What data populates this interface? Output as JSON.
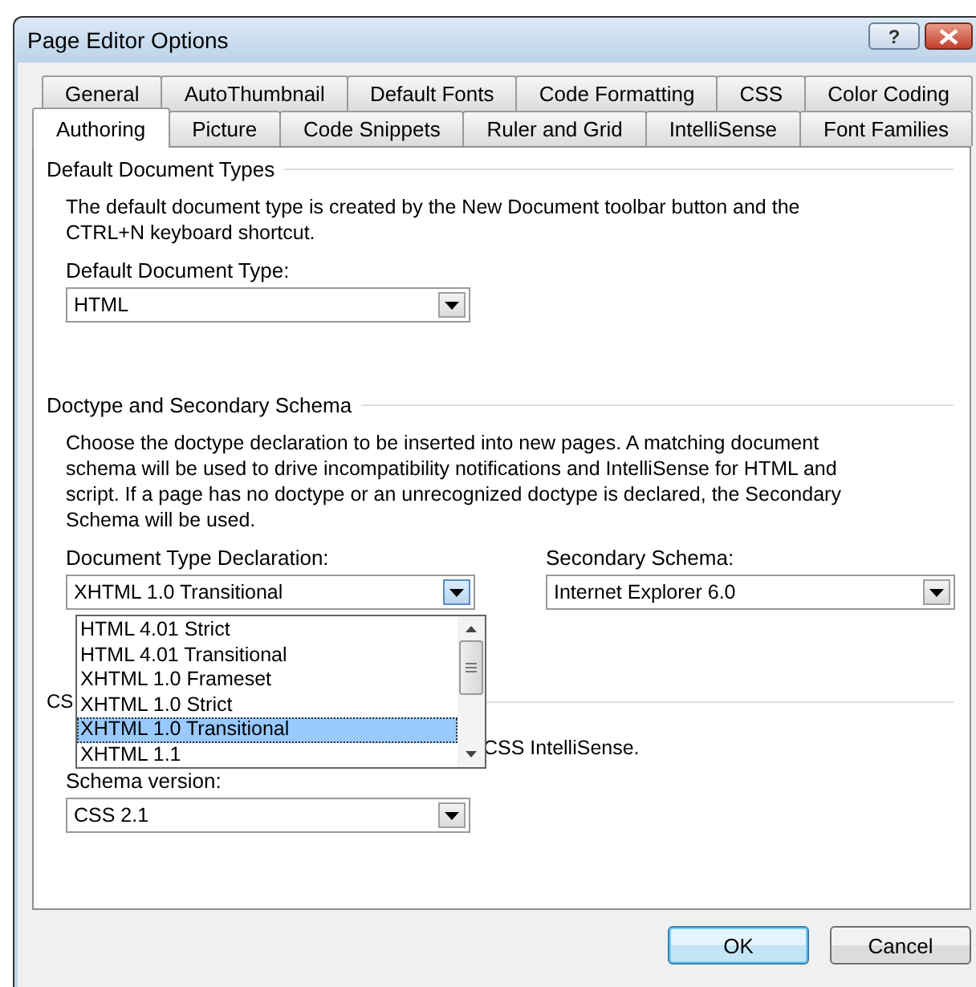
{
  "window": {
    "title": "Page Editor Options",
    "help_button": "?"
  },
  "tab_rows": [
    [
      {
        "label": "General",
        "selected": false
      },
      {
        "label": "AutoThumbnail",
        "selected": false
      },
      {
        "label": "Default Fonts",
        "selected": false
      },
      {
        "label": "Code Formatting",
        "selected": false
      },
      {
        "label": "CSS",
        "selected": false
      },
      {
        "label": "Color Coding",
        "selected": false
      }
    ],
    [
      {
        "label": "Authoring",
        "selected": true
      },
      {
        "label": "Picture",
        "selected": false
      },
      {
        "label": "Code Snippets",
        "selected": false
      },
      {
        "label": "Ruler and Grid",
        "selected": false
      },
      {
        "label": "IntelliSense",
        "selected": false
      },
      {
        "label": "Font Families",
        "selected": false
      }
    ]
  ],
  "default_group": {
    "title": "Default Document Types",
    "description": "The default document type is created by the New Document toolbar button and the CTRL+N keyboard shortcut.",
    "label": "Default Document Type:",
    "select": {
      "value": "HTML",
      "expanded": false
    }
  },
  "doctype_group": {
    "title": "Doctype and Secondary Schema",
    "description": "Choose the doctype declaration to be inserted into new pages. A matching document schema will be used to drive incompatibility notifications and IntelliSense for HTML and script. If a page has no doctype or an unrecognized doctype is declared, the Secondary Schema will be used.",
    "doctype_label": "Document Type Declaration:",
    "doctype_select": {
      "value": "XHTML 1.0 Transitional",
      "expanded": true,
      "options": [
        {
          "label": "HTML 4.01 Strict",
          "selected": false
        },
        {
          "label": "HTML 4.01 Transitional",
          "selected": false
        },
        {
          "label": "XHTML 1.0 Frameset",
          "selected": false
        },
        {
          "label": "XHTML 1.0 Strict",
          "selected": false
        },
        {
          "label": "XHTML 1.0 Transitional",
          "selected": true
        },
        {
          "label": "XHTML 1.1",
          "selected": false
        }
      ]
    },
    "schema_label": "Secondary Schema:",
    "schema_select": {
      "value": "Internet Explorer 6.0",
      "expanded": false
    }
  },
  "css_group": {
    "title": "CS",
    "description": "CSS IntelliSense.",
    "label": "Schema version:",
    "select": {
      "value": "CSS 2.1",
      "expanded": false
    }
  },
  "buttons": [
    {
      "label": "OK",
      "default": true
    },
    {
      "label": "Cancel",
      "default": false
    }
  ]
}
